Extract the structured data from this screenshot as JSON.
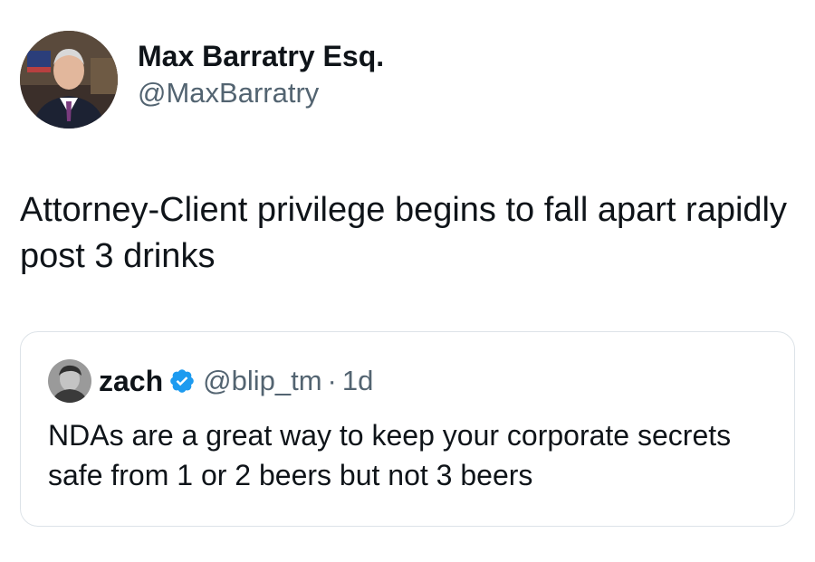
{
  "author": {
    "display_name": "Max Barratry Esq.",
    "handle": "@MaxBarratry",
    "avatar_icon": "profile-photo-man-in-suit"
  },
  "tweet": {
    "text": "Attorney-Client privilege begins to fall apart rapidly post 3 drinks"
  },
  "quoted_tweet": {
    "display_name": "zach",
    "verified": true,
    "verified_icon": "verified-badge-icon",
    "handle": "@blip_tm",
    "separator": "·",
    "time": "1d",
    "text": "NDAs are a great way to keep your corporate secrets safe from 1 or 2 beers but not 3 beers",
    "avatar_icon": "profile-photo-man-grayscale"
  },
  "colors": {
    "text_primary": "#0f1419",
    "text_secondary": "#536471",
    "border": "#dde3e8",
    "verified_blue": "#1d9bf0"
  }
}
